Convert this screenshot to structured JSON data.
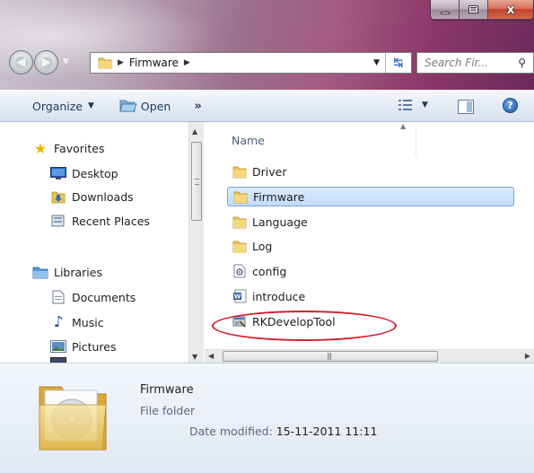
{
  "address": {
    "current": "Firmware"
  },
  "search": {
    "placeholder": "Search Fir..."
  },
  "toolbar": {
    "organize": "Organize",
    "open": "Open",
    "more": "»"
  },
  "navpane": {
    "favorites": "Favorites",
    "favorites_items": [
      "Desktop",
      "Downloads",
      "Recent Places"
    ],
    "libraries": "Libraries",
    "libraries_items": [
      "Documents",
      "Music",
      "Pictures"
    ]
  },
  "filelist": {
    "column_name": "Name",
    "items": [
      {
        "name": "Driver",
        "type": "folder"
      },
      {
        "name": "Firmware",
        "type": "folder",
        "selected": true
      },
      {
        "name": "Language",
        "type": "folder"
      },
      {
        "name": "Log",
        "type": "folder"
      },
      {
        "name": "config",
        "type": "settings-file"
      },
      {
        "name": "introduce",
        "type": "word-doc"
      },
      {
        "name": "RKDevelopTool",
        "type": "application",
        "highlighted": true
      }
    ]
  },
  "details": {
    "name": "Firmware",
    "type": "File folder",
    "modified_label": "Date modified:",
    "modified_value": "15-11-2011 11:11"
  },
  "colors": {
    "selection": "#c1dcfc",
    "highlight_ellipse": "#d21c2c",
    "folder": "#e8c25a"
  }
}
